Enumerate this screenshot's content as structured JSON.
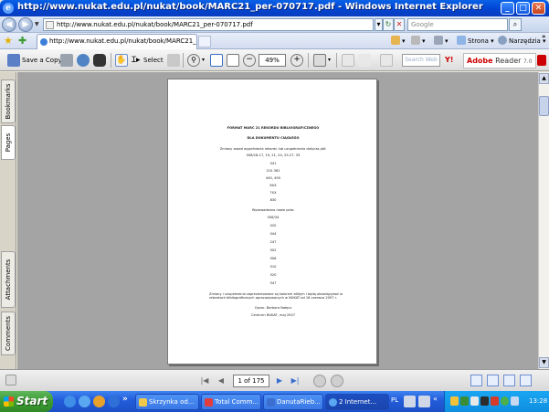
{
  "window": {
    "title": "http://www.nukat.edu.pl/nukat/book/MARC21_per-070717.pdf - Windows Internet Explorer"
  },
  "address_bar": {
    "url": "http://www.nukat.edu.pl/nukat/book/MARC21_per-070717.pdf",
    "search_placeholder": "Google"
  },
  "tab": {
    "label": "http://www.nukat.edu.pl/nukat/book/MARC21_per-0..."
  },
  "command_bar": {
    "page_label": "Strona",
    "tools_label": "Narzędzia"
  },
  "acrobat_toolbar": {
    "save_copy_label": "Save a Copy",
    "select_label": "Select",
    "zoom_value": "49%",
    "search_web_placeholder": "Search Web",
    "brand_name": "Adobe",
    "brand_product": "Reader",
    "brand_version": "7.0"
  },
  "left_panel": {
    "tabs": [
      "Bookmarks",
      "Pages",
      "Attachments",
      "Comments"
    ],
    "active_tab": "Pages"
  },
  "document": {
    "title_line1": "FORMAT MARC 21 REKORDU BIBLIOGRAFICZNEGO",
    "title_line2": "DLA DOKUMENTU CIĄGŁEGO",
    "changes_intro": "Zmiany zasad wypełniania rekordu lub uzupełnienia dotyczą pól:",
    "changed_fields": [
      "008/18-17, 19, 21, 24, 25-27, 33",
      "041",
      "210-362",
      "440, 490",
      "6XX",
      "7XX",
      "830"
    ],
    "new_fields_intro": "Wprowadzono nowe pola:",
    "new_fields": [
      "008/34",
      "020",
      "044",
      "247",
      "502",
      "506",
      "510",
      "520",
      "547"
    ],
    "closing_note": "Zmiany i uzupełnienia zaprezentowane są kolorem żółtym i będą obowiązywać w rekordach bibliograficznych opracowywanych w NUKAT od 16 czerwca 2007 r.",
    "author": "Oprac. Barbara Nałęcz",
    "footer": "Centrum NUKAT, maj 2007"
  },
  "status_bar": {
    "page_counter": "1 of 175"
  },
  "taskbar": {
    "start_label": "Start",
    "tasks": [
      {
        "label": "Skrzynka od..."
      },
      {
        "label": "Total Comm..."
      },
      {
        "label": "DanutaRieb..."
      },
      {
        "label": "2 Internet..."
      }
    ],
    "clock": "13:28",
    "language": "PL"
  }
}
